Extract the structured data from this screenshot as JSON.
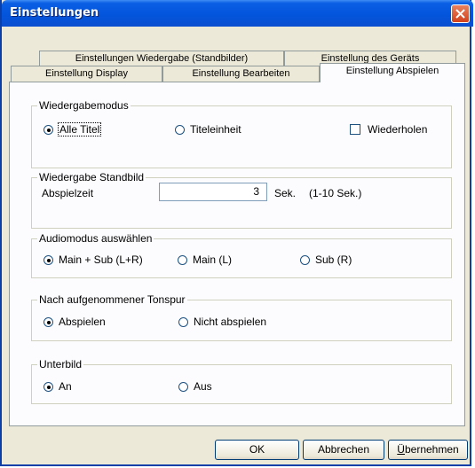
{
  "window": {
    "title": "Einstellungen",
    "close_icon": "close-icon"
  },
  "tabs": {
    "row_back": [
      "Einstellungen Wiedergabe (Standbilder)",
      "Einstellung des Geräts"
    ],
    "row_front": [
      "Einstellung Display",
      "Einstellung Bearbeiten",
      "Einstellung Abspielen"
    ],
    "active": "Einstellung Abspielen"
  },
  "groups": {
    "wiedergabemodus": {
      "title": "Wiedergabemodus",
      "options": [
        "Alle Titel",
        "Titeleinheit"
      ],
      "selected": "Alle Titel",
      "repeat_label": "Wiederholen",
      "repeat_checked": false
    },
    "standbild": {
      "title": "Wiedergabe Standbild",
      "field_label": "Abspielzeit",
      "value": "3",
      "unit": "Sek.",
      "range": "(1-10 Sek.)"
    },
    "audiomodus": {
      "title": "Audiomodus auswählen",
      "options": [
        "Main + Sub (L+R)",
        "Main (L)",
        "Sub (R)"
      ],
      "selected": "Main + Sub (L+R)"
    },
    "tonspur": {
      "title": "Nach aufgenommener Tonspur",
      "options": [
        "Abspielen",
        "Nicht abspielen"
      ],
      "selected": "Abspielen"
    },
    "unterbild": {
      "title": "Unterbild",
      "options": [
        "An",
        "Aus"
      ],
      "selected": "An"
    }
  },
  "buttons": {
    "ok": "OK",
    "cancel": "Abbrechen",
    "apply_pre": "Ü",
    "apply_rest": "bernehmen"
  }
}
